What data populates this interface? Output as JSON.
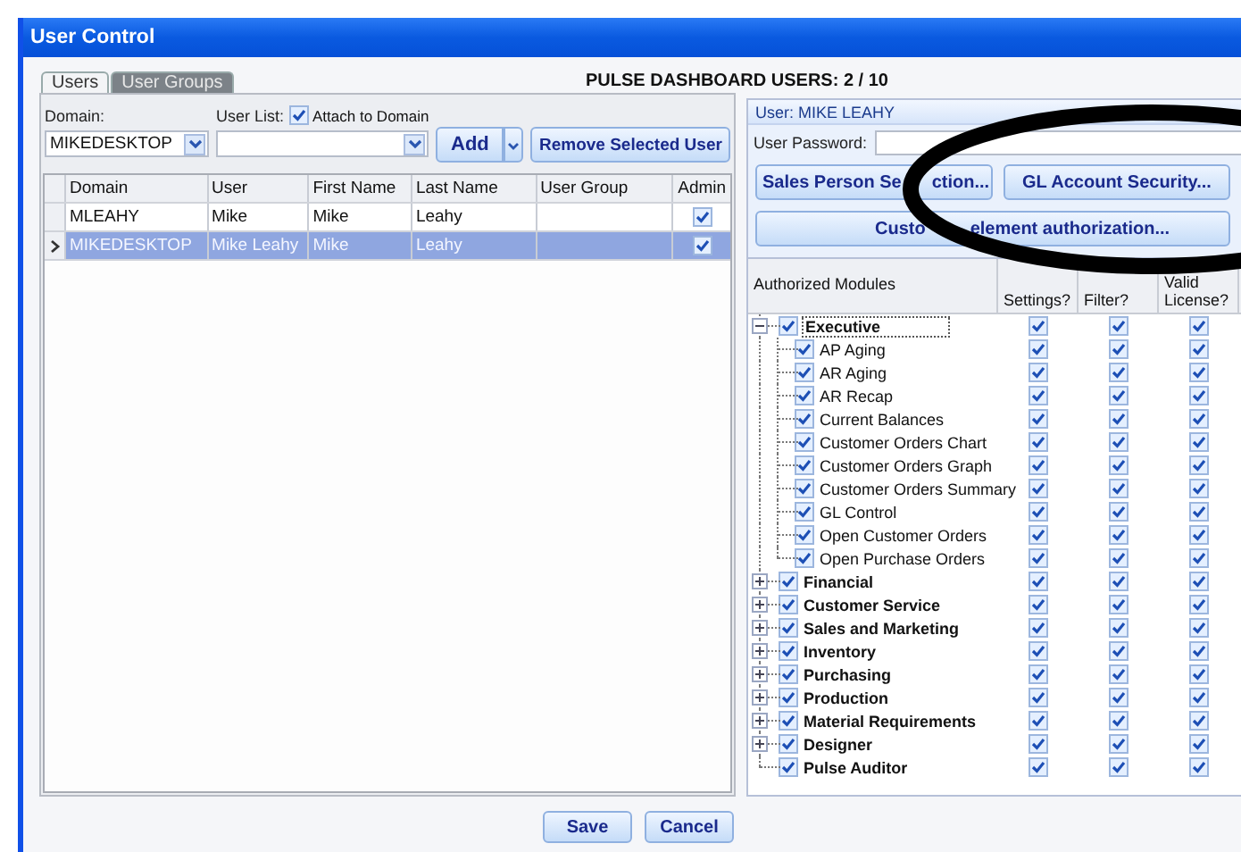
{
  "window": {
    "title": "User Control"
  },
  "header": "PULSE DASHBOARD USERS: 2 / 10",
  "tabs": [
    {
      "label": "Users",
      "selected": true
    },
    {
      "label": "User Groups",
      "selected": false
    }
  ],
  "domain": {
    "label": "Domain:",
    "value": "MIKEDESKTOP"
  },
  "user_list": {
    "label": "User List:"
  },
  "attach": {
    "label": "Attach to Domain",
    "checked": true
  },
  "add_button": "Add",
  "remove_button": "Remove Selected User",
  "users_table": {
    "columns": [
      "Domain",
      "User",
      "First Name",
      "Last Name",
      "User Group",
      "Admin"
    ],
    "rows": [
      {
        "cells": [
          "MLEAHY",
          "Mike",
          "Mike",
          "Leahy",
          ""
        ],
        "admin": true,
        "selected": false
      },
      {
        "cells": [
          "MIKEDESKTOP",
          "Mike Leahy",
          "Mike",
          "Leahy",
          ""
        ],
        "admin": true,
        "selected": true
      }
    ]
  },
  "user_panel": {
    "title": "User: MIKE LEAHY",
    "password_label": "User Password:",
    "buttons": [
      {
        "parts": [
          "Sales Person Se",
          "ction..."
        ]
      },
      {
        "parts": [
          "GL Account Security..."
        ]
      },
      {
        "parts": [
          "Custo",
          "element authorization..."
        ]
      }
    ]
  },
  "modules": {
    "columns": [
      "Authorized Modules",
      "Settings?",
      "Filter?",
      "Valid License?"
    ],
    "items": [
      {
        "name": "Executive",
        "checked": true,
        "expanded": true,
        "flags": [
          true,
          true,
          true
        ],
        "children": [
          {
            "name": "AP Aging",
            "checked": true,
            "flags": [
              true,
              true,
              true
            ]
          },
          {
            "name": "AR Aging",
            "checked": true,
            "flags": [
              true,
              true,
              true
            ]
          },
          {
            "name": "AR Recap",
            "checked": true,
            "flags": [
              true,
              true,
              true
            ]
          },
          {
            "name": "Current Balances",
            "checked": true,
            "flags": [
              true,
              true,
              true
            ]
          },
          {
            "name": "Customer Orders Chart",
            "checked": true,
            "flags": [
              true,
              true,
              true
            ]
          },
          {
            "name": "Customer Orders Graph",
            "checked": true,
            "flags": [
              true,
              true,
              true
            ]
          },
          {
            "name": "Customer Orders Summary",
            "checked": true,
            "flags": [
              true,
              true,
              true
            ]
          },
          {
            "name": "GL Control",
            "checked": true,
            "flags": [
              true,
              true,
              true
            ]
          },
          {
            "name": "Open Customer Orders",
            "checked": true,
            "flags": [
              true,
              true,
              true
            ]
          },
          {
            "name": "Open Purchase Orders",
            "checked": true,
            "flags": [
              true,
              true,
              true
            ]
          }
        ]
      },
      {
        "name": "Financial",
        "checked": true,
        "expanded": false,
        "flags": [
          true,
          true,
          true
        ]
      },
      {
        "name": "Customer Service",
        "checked": true,
        "expanded": false,
        "flags": [
          true,
          true,
          true
        ]
      },
      {
        "name": "Sales and Marketing",
        "checked": true,
        "expanded": false,
        "flags": [
          true,
          true,
          true
        ]
      },
      {
        "name": "Inventory",
        "checked": true,
        "expanded": false,
        "flags": [
          true,
          true,
          true
        ]
      },
      {
        "name": "Purchasing",
        "checked": true,
        "expanded": false,
        "flags": [
          true,
          true,
          true
        ]
      },
      {
        "name": "Production",
        "checked": true,
        "expanded": false,
        "flags": [
          true,
          true,
          true
        ]
      },
      {
        "name": "Material Requirements",
        "checked": true,
        "expanded": false,
        "flags": [
          true,
          true,
          true
        ]
      },
      {
        "name": "Designer",
        "checked": true,
        "expanded": false,
        "flags": [
          true,
          true,
          true
        ]
      },
      {
        "name": "Pulse Auditor",
        "checked": true,
        "flags": [
          true,
          true,
          true
        ]
      }
    ]
  },
  "footer_buttons": [
    "Save",
    "Cancel"
  ]
}
